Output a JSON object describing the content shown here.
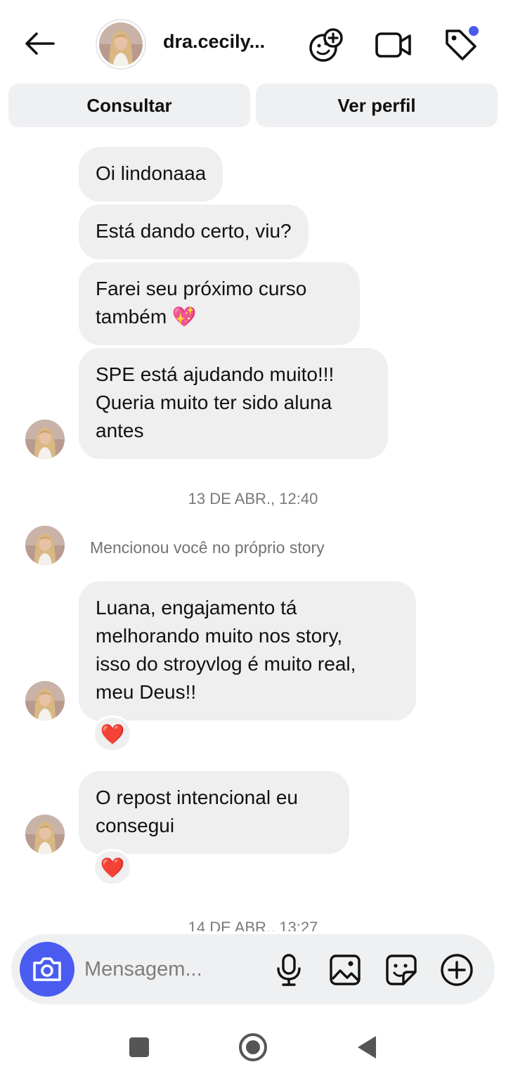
{
  "header": {
    "username": "dra.cecily...",
    "icons": [
      "back-arrow-icon",
      "avatar",
      "add-emoji-icon",
      "video-call-icon",
      "tag-icon"
    ],
    "notification_dot_color": "#4a5cf0"
  },
  "actions": {
    "consult_label": "Consultar",
    "profile_label": "Ver perfil"
  },
  "messages": {
    "m1": "Oi lindonaaa",
    "m2": "Está dando certo, viu?",
    "m3_line1": "Farei seu próximo curso",
    "m3_line2": "também 💖",
    "m4_line1": "SPE está ajudando muito!!!",
    "m4_line2": "Queria muito ter sido aluna",
    "m4_line3": "antes",
    "timestamp1": "13 DE ABR., 12:40",
    "mention": "Mencionou você no próprio story",
    "m5_line1": "Luana, engajamento tá",
    "m5_line2": "melhorando muito nos story,",
    "m5_line3": "isso do stroyvlog é muito real,",
    "m5_line4": "meu Deus!!",
    "m5_reaction": "❤️",
    "m6_line1": "O repost intencional eu",
    "m6_line2": "consegui",
    "m6_reaction": "❤️",
    "timestamp2": "14 DE ABR., 13:27"
  },
  "composer": {
    "placeholder": "Mensagem...",
    "accent": "#4a5cf0",
    "icons": [
      "camera-icon",
      "microphone-icon",
      "gallery-icon",
      "sticker-icon",
      "plus-icon"
    ]
  },
  "navbar": {
    "icons": [
      "recent-apps-icon",
      "home-icon",
      "back-icon"
    ]
  }
}
